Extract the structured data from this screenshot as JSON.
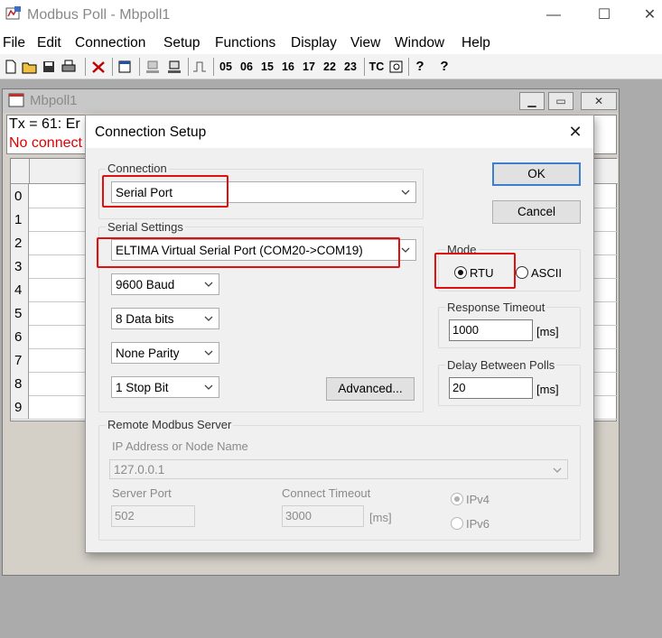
{
  "app": {
    "title": "Modbus Poll - Mbpoll1",
    "caption_min": "—",
    "caption_max": "☐",
    "caption_close": "✕"
  },
  "menu": [
    "File",
    "Edit",
    "Connection",
    "Setup",
    "Functions",
    "Display",
    "View",
    "Window",
    "Help"
  ],
  "toolbar": {
    "func_codes": [
      "05",
      "06",
      "15",
      "16",
      "17",
      "22",
      "23"
    ],
    "tc": "TC",
    "help": "?",
    "context_help": "?"
  },
  "child": {
    "title": "Mbpoll1",
    "tx_line": "Tx = 61: Er",
    "no_connection": "No connect",
    "rows": [
      "0",
      "1",
      "2",
      "3",
      "4",
      "5",
      "6",
      "7",
      "8",
      "9"
    ]
  },
  "dialog": {
    "title": "Connection Setup",
    "close": "✕",
    "connection": {
      "label": "Connection",
      "value": "Serial Port"
    },
    "serial": {
      "label": "Serial Settings",
      "port": "ELTIMA Virtual Serial Port (COM20->COM19)",
      "baud": "9600 Baud",
      "data_bits": "8 Data bits",
      "parity": "None Parity",
      "stop_bit": "1 Stop Bit",
      "advanced": "Advanced..."
    },
    "ok": "OK",
    "cancel": "Cancel",
    "mode": {
      "label": "Mode",
      "rtu": "RTU",
      "ascii": "ASCII",
      "selected": "RTU"
    },
    "response_timeout": {
      "label": "Response Timeout",
      "value": "1000",
      "unit": "[ms]"
    },
    "delay_polls": {
      "label": "Delay Between Polls",
      "value": "20",
      "unit": "[ms]"
    },
    "remote": {
      "label": "Remote Modbus Server",
      "ip_label": "IP Address or Node Name",
      "ip_value": "127.0.0.1",
      "port_label": "Server Port",
      "port_value": "502",
      "timeout_label": "Connect Timeout",
      "timeout_value": "3000",
      "timeout_unit": "[ms]",
      "ipv4": "IPv4",
      "ipv6": "IPv6"
    }
  },
  "colors": {
    "highlight_box": "#e01010",
    "error_text": "#e00000",
    "default_button_border": "#3c7fd1"
  }
}
